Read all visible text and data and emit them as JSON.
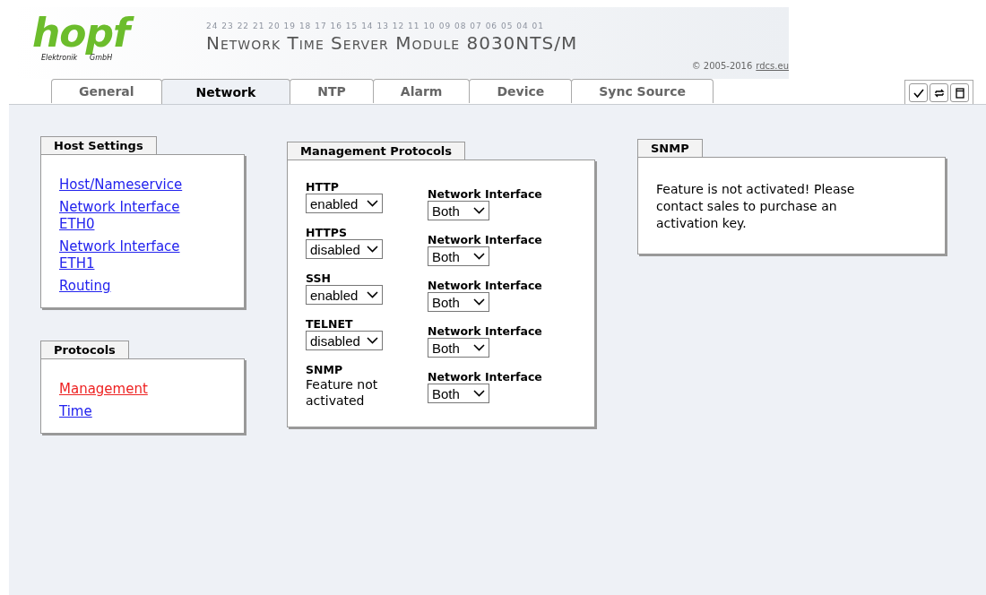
{
  "header": {
    "logo": "hopf",
    "logo_subtitle_left": "Elektronik",
    "logo_subtitle_right": "GmbH",
    "hour_scale": "24 23 22 21 20 19 18 17 16 15 14 13 12 11 10 09 08 07 06 05 04 01",
    "title": "Network Time Server Module 8030NTS/M",
    "copyright": "© 2005-2016",
    "copyright_link": "rdcs.eu"
  },
  "tabs": [
    {
      "label": "General",
      "selected": false
    },
    {
      "label": "Network",
      "selected": true
    },
    {
      "label": "NTP",
      "selected": false
    },
    {
      "label": "Alarm",
      "selected": false
    },
    {
      "label": "Device",
      "selected": false
    },
    {
      "label": "Sync Source",
      "selected": false
    }
  ],
  "sidebar": [
    {
      "title": "Host Settings",
      "links": [
        {
          "label": "Host/Nameservice",
          "selected": false
        },
        {
          "label": "Network Interface ETH0",
          "selected": false
        },
        {
          "label": "Network Interface ETH1",
          "selected": false
        },
        {
          "label": "Routing",
          "selected": false
        }
      ]
    },
    {
      "title": "Protocols",
      "links": [
        {
          "label": "Management",
          "selected": true
        },
        {
          "label": "Time",
          "selected": false
        }
      ]
    }
  ],
  "management": {
    "title": "Management Protocols",
    "rows": [
      {
        "name": "HTTP",
        "kind": "select",
        "value": "enabled",
        "interface_label": "Network Interface",
        "interface": "Both"
      },
      {
        "name": "HTTPS",
        "kind": "select",
        "value": "disabled",
        "interface_label": "Network Interface",
        "interface": "Both"
      },
      {
        "name": "SSH",
        "kind": "select",
        "value": "enabled",
        "interface_label": "Network Interface",
        "interface": "Both"
      },
      {
        "name": "TELNET",
        "kind": "select",
        "value": "disabled",
        "interface_label": "Network Interface",
        "interface": "Both"
      },
      {
        "name": "SNMP",
        "kind": "text",
        "value": "Feature not activated",
        "interface_label": "Network Interface",
        "interface": "Both"
      }
    ]
  },
  "snmp": {
    "title": "SNMP",
    "message": "Feature is not activated! Please contact sales to purchase an activation key."
  }
}
